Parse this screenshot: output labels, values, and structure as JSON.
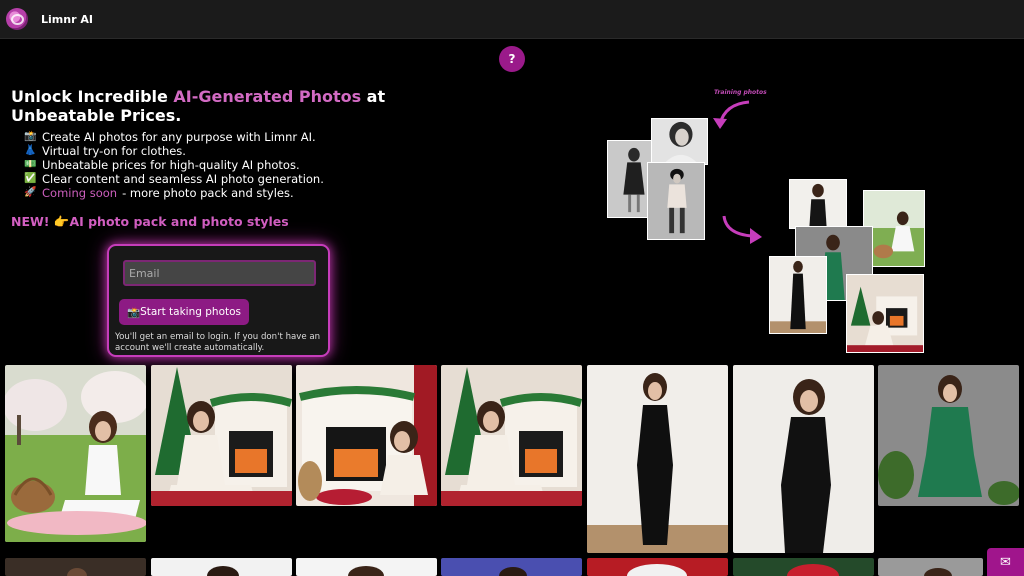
{
  "header": {
    "brand": "Limnr AI"
  },
  "help": {
    "label": "?"
  },
  "hero": {
    "headline_pre": "Unlock Incredible ",
    "headline_highlight": "AI-Generated Photos",
    "headline_post": " at Unbeatable Prices.",
    "features": [
      {
        "icon": "📸",
        "text": "Create AI photos for any purpose with Limnr AI."
      },
      {
        "icon": "👗",
        "text": "Virtual try-on for clothes."
      },
      {
        "icon": "💵",
        "text": "Unbeatable prices for high-quality AI photos."
      },
      {
        "icon": "✅",
        "text": "Clear content and seamless AI photo generation."
      }
    ],
    "last_feature": {
      "icon": "🚀",
      "soon": "Coming soon",
      "text": " - more photo pack and styles."
    },
    "new_badge": "NEW!",
    "new_icon": "👉",
    "new_text": "AI photo pack and photo styles"
  },
  "signup": {
    "email_placeholder": "Email",
    "button_icon": "📸",
    "button_label": "Start taking photos",
    "note": "You'll get an email to login. If you don't have an account we'll create automatically."
  },
  "diagram": {
    "training_label": "Training photos"
  },
  "colors": {
    "accent": "#c63dbb",
    "button": "#8d1b84",
    "highlight": "#d36bc4",
    "background": "#000000"
  },
  "mail_icon": "mail-icon"
}
